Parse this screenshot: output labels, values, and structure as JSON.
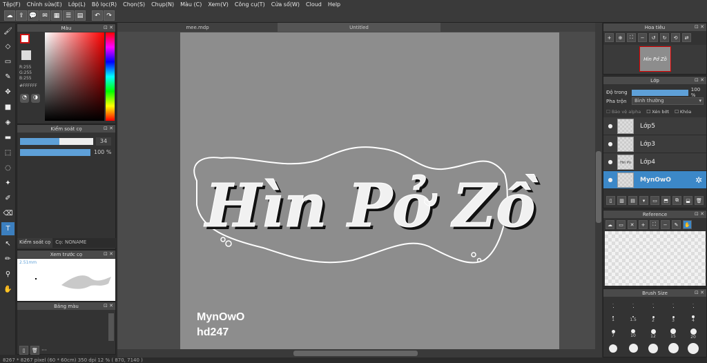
{
  "menu": [
    "Tệp(F)",
    "Chỉnh sửa(E)",
    "Lớp(L)",
    "Bộ lọc(R)",
    "Chọn(S)",
    "Chụp(N)",
    "Màu (C)",
    "Xem(V)",
    "Công cụ(T)",
    "Cửa sổ(W)",
    "Cloud",
    "Help"
  ],
  "color_panel": {
    "title": "Màu",
    "r": "R:255",
    "g": "G:255",
    "b": "B:255",
    "hex": "#FFFFFF"
  },
  "brush_control": {
    "title": "Kiểm soát cọ",
    "size": "34",
    "opacity": "100 %",
    "size_fraction": 0.54,
    "opacity_fraction": 1.0,
    "tab1": "Kiểm soát cọ",
    "tab2": "Cọ: NONAME"
  },
  "brush_preview": {
    "title": "Xem trước cọ",
    "size_label": "2.51mm"
  },
  "palette": {
    "title": "Bảng màu",
    "more": "···"
  },
  "document_tabs": [
    "mee.mdp",
    "Untitled"
  ],
  "artwork": {
    "title_text": "Hìn Pở Zồ",
    "sig1": "MynOwO",
    "sig2": "hd247"
  },
  "navigator": {
    "title": "Hoa tiêu",
    "thumb_text": "Hìn Pở Zồ"
  },
  "layer_panel": {
    "title": "Lớp",
    "opacity_label": "Độ trong",
    "opacity_value": "100 %",
    "opacity_fraction": 1.0,
    "blend_label": "Pha trộn",
    "blend_value": "Bình thường",
    "protect_alpha": "Bảo vệ alpha",
    "clipping": "Xén bớt",
    "lock": "Khóa"
  },
  "layers": [
    {
      "name": "Lớp5",
      "selected": false,
      "thumb": ""
    },
    {
      "name": "Lớp3",
      "selected": false,
      "thumb": ""
    },
    {
      "name": "Lớp4",
      "selected": false,
      "thumb": "Hin Po Zo"
    },
    {
      "name": "MynOwO",
      "selected": true,
      "thumb": ""
    }
  ],
  "reference": {
    "title": "Reference"
  },
  "brush_size": {
    "title": "Brush Size",
    "labels": [
      "·",
      "·",
      "·",
      "·",
      "·",
      "1",
      "1.5",
      "2",
      "3",
      "4",
      "7",
      "10",
      "12",
      "15",
      "20",
      "",
      "",
      "",
      "",
      ""
    ]
  },
  "status": "8267 * 8267 pixel  (60 * 60cm)  350 dpi  12 %  ( 870, 7140 )",
  "colors": {
    "accent": "#3c88c8",
    "panel": "#333333",
    "canvas_bg": "#8d8d8d"
  }
}
